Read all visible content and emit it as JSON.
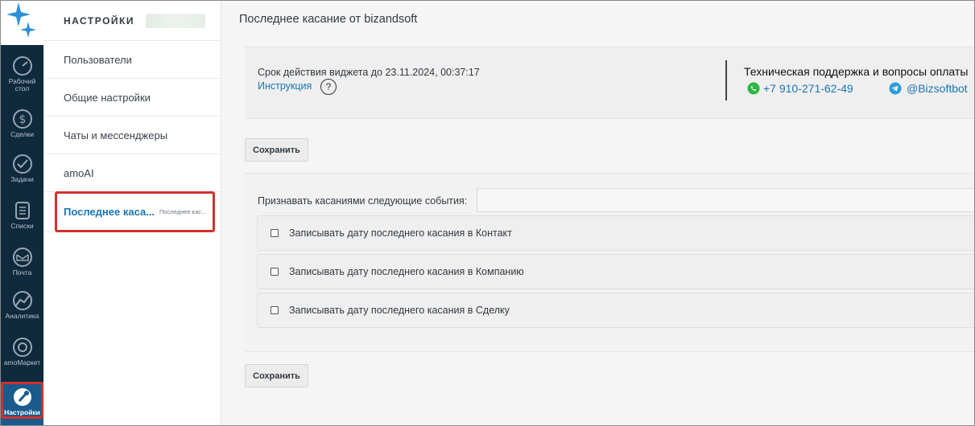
{
  "rail": {
    "items": [
      {
        "label": "Рабочий стол",
        "icon": "dashboard-icon"
      },
      {
        "label": "Сделки",
        "icon": "dollar-icon"
      },
      {
        "label": "Задачи",
        "icon": "checkmark-icon"
      },
      {
        "label": "Списки",
        "icon": "list-icon"
      },
      {
        "label": "Почта",
        "icon": "mail-icon"
      },
      {
        "label": "Аналитика",
        "icon": "analytics-icon"
      },
      {
        "label": "amoМаркет",
        "icon": "market-icon"
      },
      {
        "label": "Настройки",
        "icon": "settings-icon"
      }
    ]
  },
  "subnav": {
    "title": "НАСТРОЙКИ",
    "items": [
      {
        "label": "Пользователи"
      },
      {
        "label": "Общие настройки"
      },
      {
        "label": "Чаты и мессенджеры"
      },
      {
        "label": "amoAI"
      },
      {
        "label": "Последнее каса...",
        "sublabel": "Последнее кас..."
      }
    ]
  },
  "main": {
    "title": "Последнее касание от bizandsoft",
    "expire_text": "Срок действия виджета до 23.11.2024, 00:37:17",
    "instruction_link": "Инструкция",
    "help_symbol": "?",
    "support_title": "Техническая поддержка и вопросы оплаты",
    "support_phone": "+7 910-271-62-49",
    "support_telegram": "@Bizsoftbot",
    "save_label": "Сохранить",
    "events_label": "Признавать касаниями следующие события:",
    "events_value": "",
    "checkboxes": [
      {
        "label": "Записывать дату последнего касания в Контакт",
        "checked": false
      },
      {
        "label": "Записывать дату последнего касания в Компанию",
        "checked": false
      },
      {
        "label": "Записывать дату последнего касания в Сделку",
        "checked": false
      }
    ]
  },
  "colors": {
    "rail_bg": "#0f2a3d",
    "accent": "#1b74b4",
    "highlight": "#d0312d",
    "whatsapp": "#2bb741",
    "telegram": "#2a9ed8"
  }
}
